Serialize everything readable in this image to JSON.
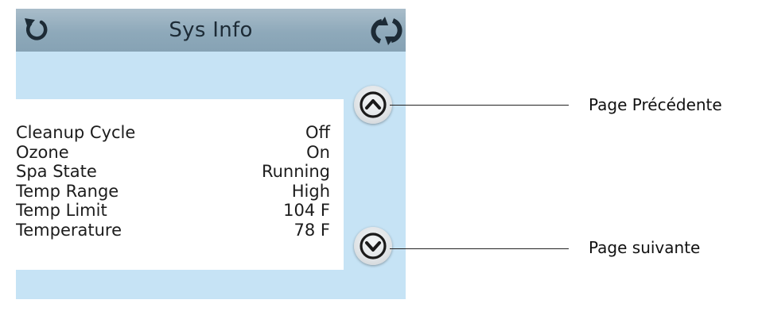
{
  "header": {
    "title": "Sys Info",
    "left_icon": "back-icon",
    "right_icon": "refresh-icon"
  },
  "info_rows": [
    {
      "label": "Cleanup Cycle",
      "value": "Off"
    },
    {
      "label": "Ozone",
      "value": "On"
    },
    {
      "label": "Spa State",
      "value": "Running"
    },
    {
      "label": "Temp Range",
      "value": "High"
    },
    {
      "label": "Temp Limit",
      "value": "104 F"
    },
    {
      "label": "Temperature",
      "value": "78 F"
    }
  ],
  "nav": {
    "up_icon": "chevron-up-icon",
    "down_icon": "chevron-down-icon"
  },
  "callouts": {
    "previous": "Page Précédente",
    "next": "Page suivante"
  },
  "colors": {
    "panel_bg": "#c6e3f5",
    "titlebar": "#8ea9ba",
    "icon_dark": "#1d2b36"
  }
}
